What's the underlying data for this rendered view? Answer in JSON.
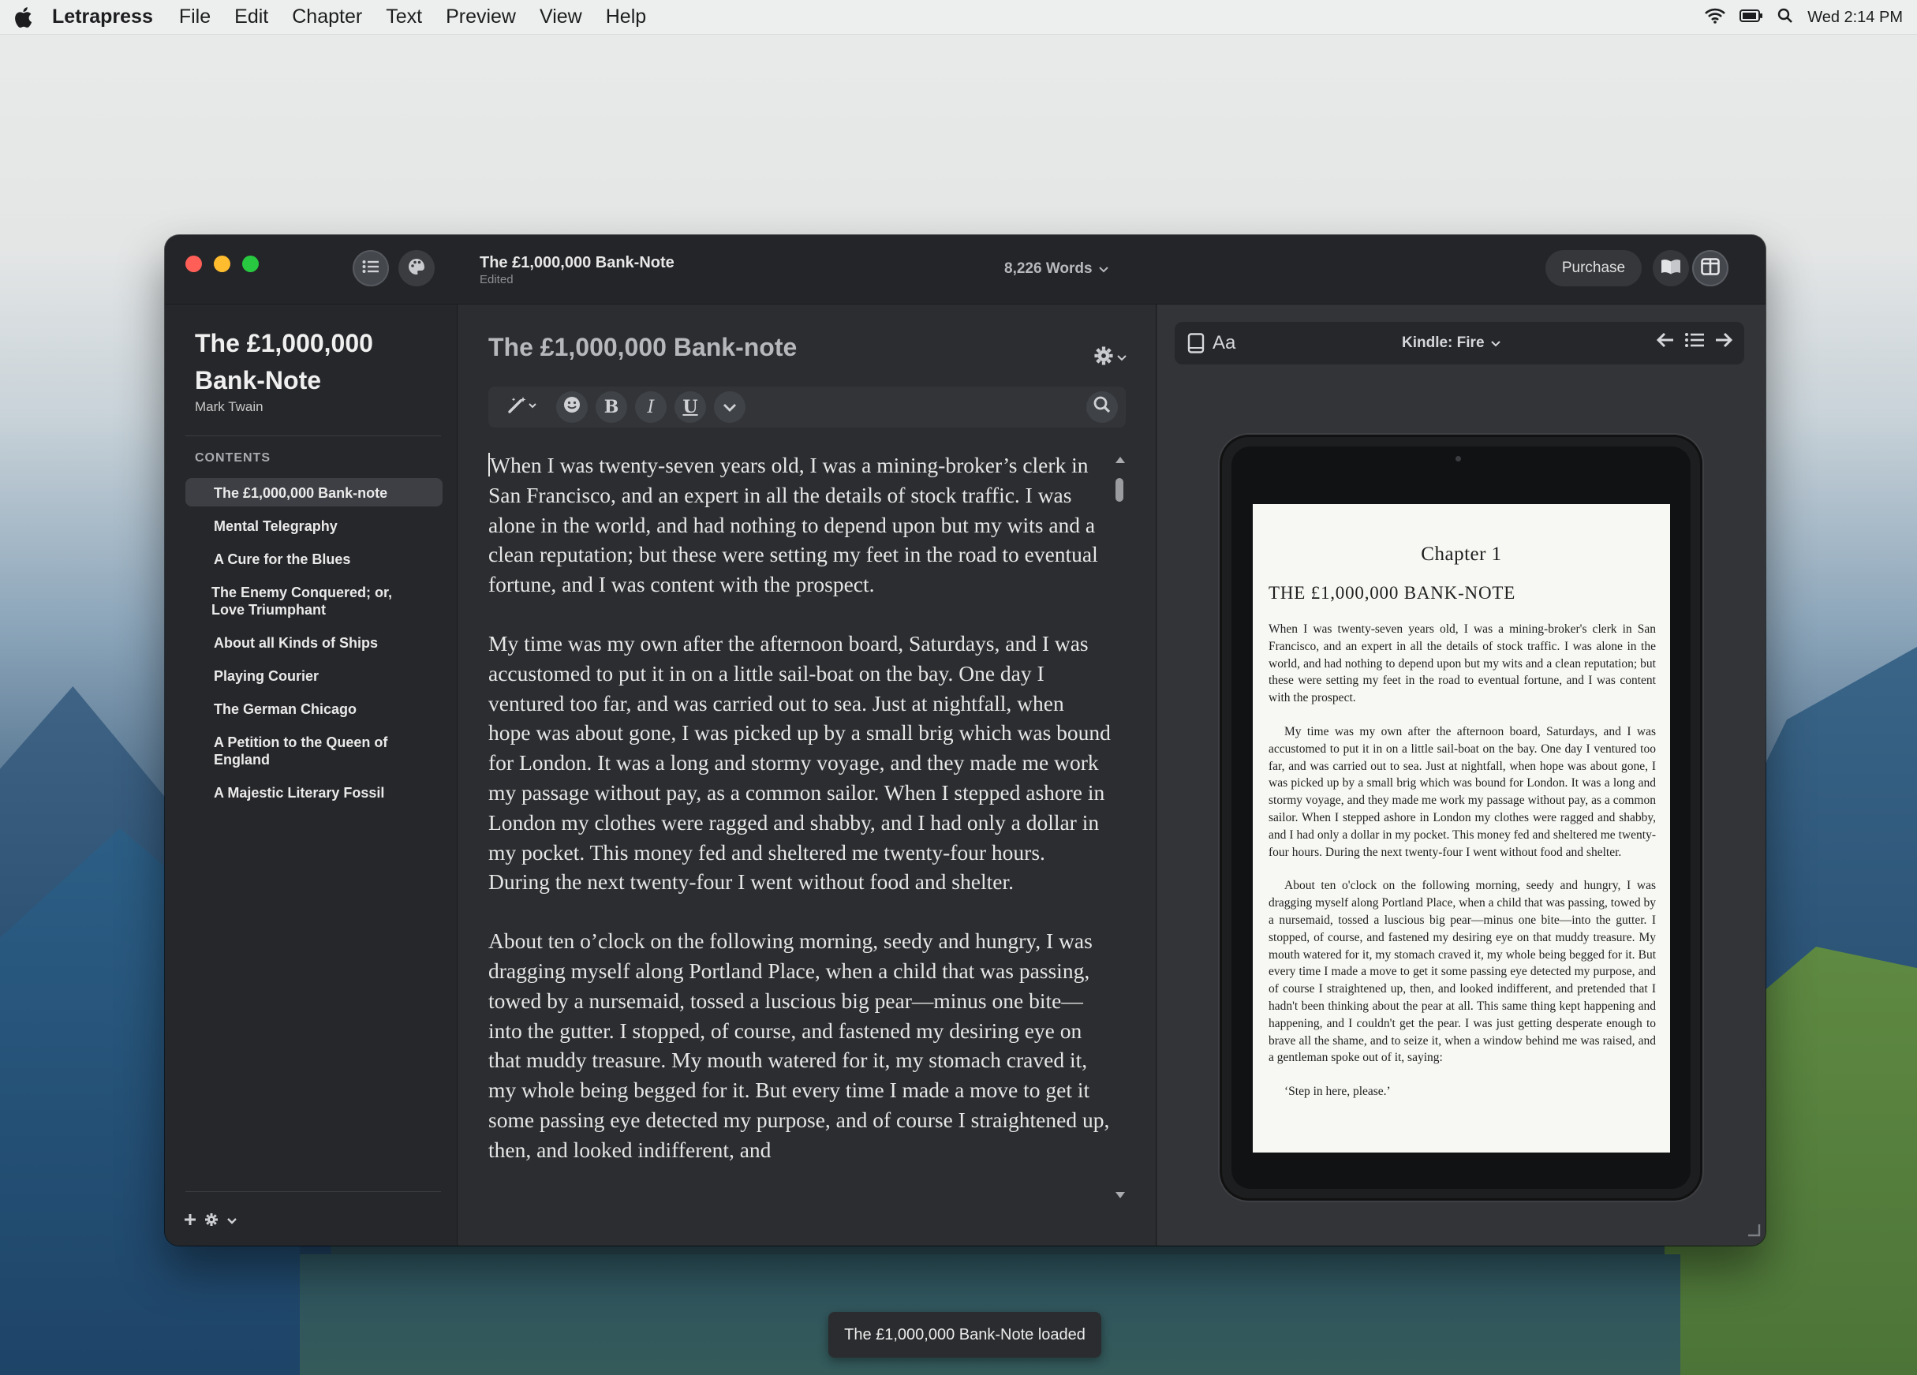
{
  "menubar": {
    "app_name": "Letrapress",
    "items": [
      "File",
      "Edit",
      "Chapter",
      "Text",
      "Preview",
      "View",
      "Help"
    ],
    "clock": "Wed 2:14 PM"
  },
  "window": {
    "doc_title": "The £1,000,000 Bank-Note",
    "doc_status": "Edited",
    "word_count": "8,226 Words",
    "purchase_label": "Purchase"
  },
  "sidebar": {
    "book_title": "The £1,000,000 Bank-Note",
    "author": "Mark Twain",
    "contents_heading": "CONTENTS",
    "chapters": [
      "The £1,000,000 Bank-note",
      "Mental Telegraphy",
      "A Cure for the Blues",
      "The Enemy Conquered; or, Love Triumphant",
      "About all Kinds of Ships",
      "Playing Courier",
      "The German Chicago",
      "A Petition to the Queen of England",
      "A Majestic Literary Fossil"
    ],
    "selected_index": 0
  },
  "editor": {
    "chapter_title": "The £1,000,000 Bank-note",
    "toolbar": {
      "bold": "B",
      "italic": "I",
      "underline": "U"
    },
    "paragraphs": [
      "When I was twenty-seven years old, I was a mining-broker’s clerk in San Francisco, and an expert in all the details of stock traffic. I was alone in the world, and had nothing to depend upon but my wits and a clean reputation; but these were setting my feet in the road to eventual fortune, and I was content with the prospect.",
      "My time was my own after the afternoon board, Saturdays, and I was accustomed to put it in on a little sail-boat on the bay. One day I ventured too far, and was carried out to sea. Just at nightfall, when hope was about gone, I was picked up by a small brig which was bound for London. It was a long and stormy voyage, and they made me work my passage without pay, as a common sailor. When I stepped ashore in London my clothes were ragged and shabby, and I had only a dollar in my pocket. This money fed and sheltered me twenty-four hours. During the next twenty-four I went without food and shelter.",
      "About ten o’clock on the following morning, seedy and hungry, I was dragging myself along Portland Place, when a child that was passing, towed by a nursemaid, tossed a luscious big pear—minus one bite—into the gutter. I stopped, of course, and fastened my desiring eye on that muddy treasure. My mouth watered for it, my stomach craved it, my whole being begged for it. But every time I made a move to get it some passing eye detected my purpose, and of course I straightened up, then, and looked indifferent, and"
    ]
  },
  "preview": {
    "font_button": "Aa",
    "device": "Kindle: Fire",
    "page": {
      "chapter_number": "Chapter 1",
      "chapter_title": "THE £1,000,000 BANK-NOTE",
      "paragraphs": [
        "When I was twenty-seven years old, I was a mining-broker's clerk in San Francisco, and an expert in all the details of stock traffic. I was alone in the world, and had nothing to depend upon but my wits and a clean reputation; but these were setting my feet in the road to eventual fortune, and I was content with the prospect.",
        "My time was my own after the afternoon board, Saturdays, and I was accustomed to put it in on a little sail-boat on the bay. One day I ventured too far, and was carried out to sea. Just at nightfall, when hope was about gone, I was picked up by a small brig which was bound for London. It was a long and stormy voyage, and they made me work my passage without pay, as a common sailor. When I stepped ashore in London my clothes were ragged and shabby, and I had only a dollar in my pocket. This money fed and sheltered me twenty-four hours. During the next twenty-four I went without food and shelter.",
        "About ten o'clock on the following morning, seedy and hungry, I was dragging myself along Portland Place, when a child that was passing, towed by a nursemaid, tossed a luscious big pear—minus one bite—into the gutter. I stopped, of course, and fastened my desiring eye on that muddy treasure. My mouth watered for it, my stomach craved it, my whole being begged for it. But every time I made a move to get it some passing eye detected my purpose, and of course I straightened up, then, and looked indifferent, and pretended that I hadn't been thinking about the pear at all. This same thing kept happening and happening, and I couldn't get the pear. I was just getting desperate enough to brave all the shame, and to seize it, when a window behind me was raised, and a gentleman spoke out of it, saying:",
        "‘Step in here, please.’"
      ]
    }
  },
  "toast": "The £1,000,000 Bank-Note loaded",
  "colors": {
    "window_bg": "#2b2d30",
    "sidebar_bg": "#26272a",
    "accent_red": "#ff5f57",
    "accent_yellow": "#febc2e",
    "accent_green": "#28c840",
    "page_bg": "#f7f7f3"
  }
}
